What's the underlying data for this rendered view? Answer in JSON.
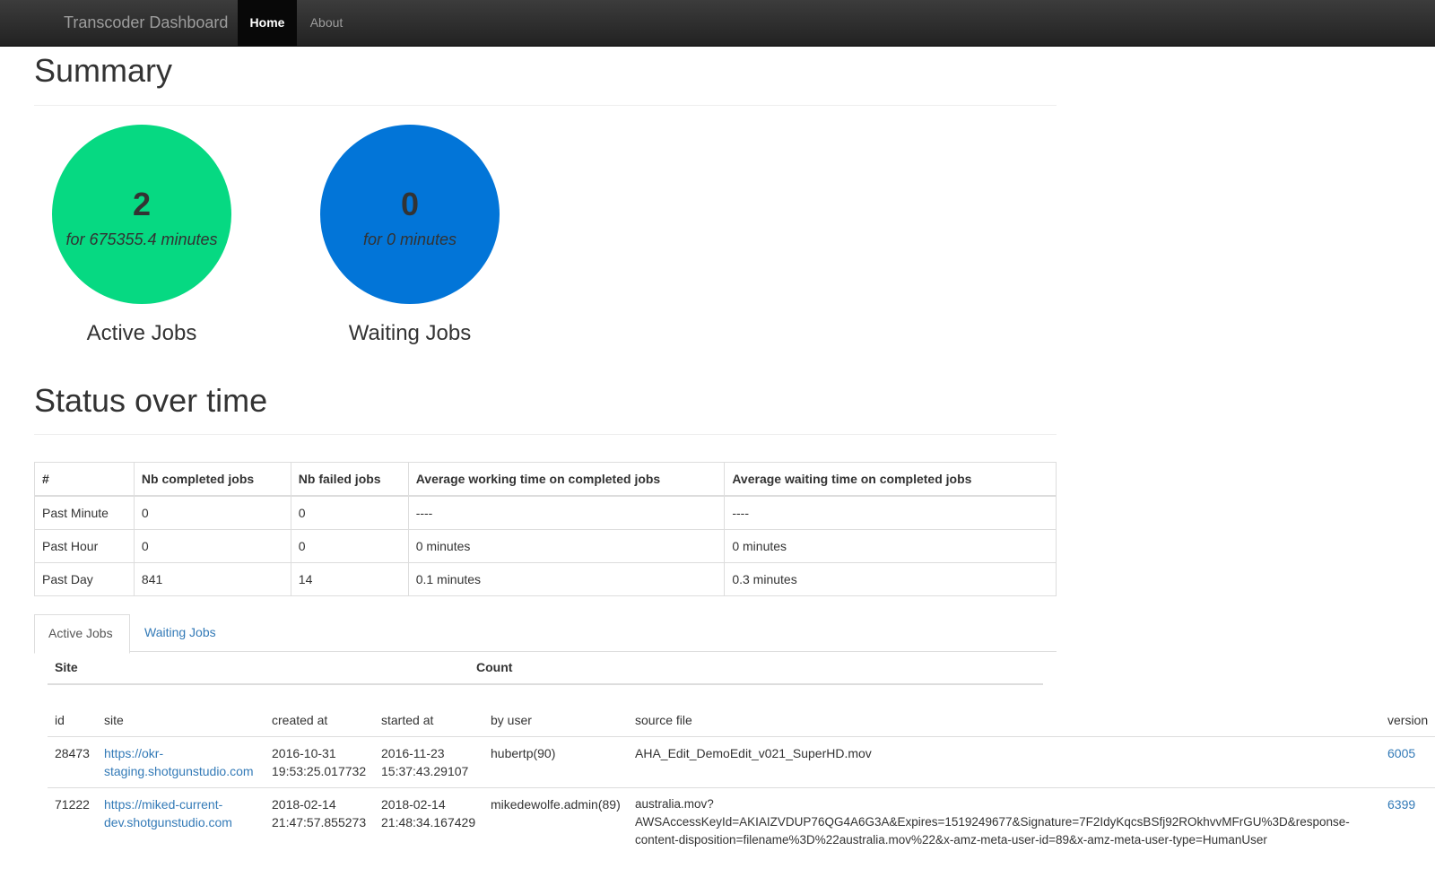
{
  "navbar": {
    "brand": "Transcoder Dashboard",
    "items": [
      {
        "label": "Home",
        "active": true
      },
      {
        "label": "About",
        "active": false
      }
    ]
  },
  "summary": {
    "title": "Summary",
    "active": {
      "count": "2",
      "duration": "for 675355.4 minutes",
      "label": "Active Jobs",
      "color": "#06d982"
    },
    "waiting": {
      "count": "0",
      "duration": "for 0 minutes",
      "label": "Waiting Jobs",
      "color": "#0275d8"
    }
  },
  "status": {
    "title": "Status over time",
    "headers": [
      "#",
      "Nb completed jobs",
      "Nb failed jobs",
      "Average working time on completed jobs",
      "Average waiting time on completed jobs"
    ],
    "rows": [
      [
        "Past Minute",
        "0",
        "0",
        "----",
        "----"
      ],
      [
        "Past Hour",
        "0",
        "0",
        "0 minutes",
        "0 minutes"
      ],
      [
        "Past Day",
        "841",
        "14",
        "0.1 minutes",
        "0.3 minutes"
      ]
    ]
  },
  "tabs": [
    {
      "label": "Active Jobs",
      "active": true
    },
    {
      "label": "Waiting Jobs",
      "active": false
    }
  ],
  "site_count": {
    "site_header": "Site",
    "count_header": "Count"
  },
  "jobs": {
    "headers": [
      "id",
      "site",
      "created at",
      "started at",
      "by user",
      "source file",
      "version"
    ],
    "rows": [
      {
        "id": "28473",
        "site_line1": "https://okr-",
        "site_line2": "staging.shotgunstudio.com",
        "created_date": "2016-10-31",
        "created_time": "19:53:25.017732",
        "started_date": "2016-11-23",
        "started_time": "15:37:43.29107",
        "user": "hubertp(90)",
        "source_line1": "AHA_Edit_DemoEdit_v021_SuperHD.mov",
        "source_line2": "",
        "source_line3": "",
        "version": "6005"
      },
      {
        "id": "71222",
        "site_line1": "https://miked-current-",
        "site_line2": "dev.shotgunstudio.com",
        "created_date": "2018-02-14",
        "created_time": "21:47:57.855273",
        "started_date": "2018-02-14",
        "started_time": "21:48:34.167429",
        "user": "mikedewolfe.admin(89)",
        "source_line1": "australia.mov?",
        "source_line2": "AWSAccessKeyId=AKIAIZVDUP76QG4A6G3A&Expires=1519249677&Signature=7F2IdyKqcsBSfj92ROkhvvMFrGU%3D&response-",
        "source_line3": "content-disposition=filename%3D%22australia.mov%22&x-amz-meta-user-id=89&x-amz-meta-user-type=HumanUser",
        "version": "6399"
      }
    ]
  }
}
